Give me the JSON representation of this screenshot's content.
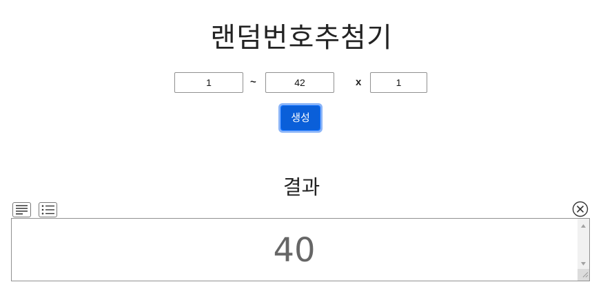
{
  "page": {
    "title": "랜덤번호추첨기"
  },
  "range": {
    "min_value": "1",
    "separator": "~",
    "max_value": "42",
    "times_symbol": "x",
    "count_value": "1"
  },
  "generate_button": {
    "label": "생성"
  },
  "result": {
    "heading": "결과",
    "value": "40"
  },
  "icons": {
    "text_view": "text-lines-icon",
    "list_view": "bullet-list-icon",
    "close": "circle-x-icon",
    "scroll_up": "triangle-up-icon",
    "scroll_down": "triangle-down-icon",
    "resize": "resize-grip-icon"
  },
  "colors": {
    "button_bg": "#0d6efd",
    "button_focus_ring": "#8ab4f8",
    "result_text": "#666666"
  }
}
